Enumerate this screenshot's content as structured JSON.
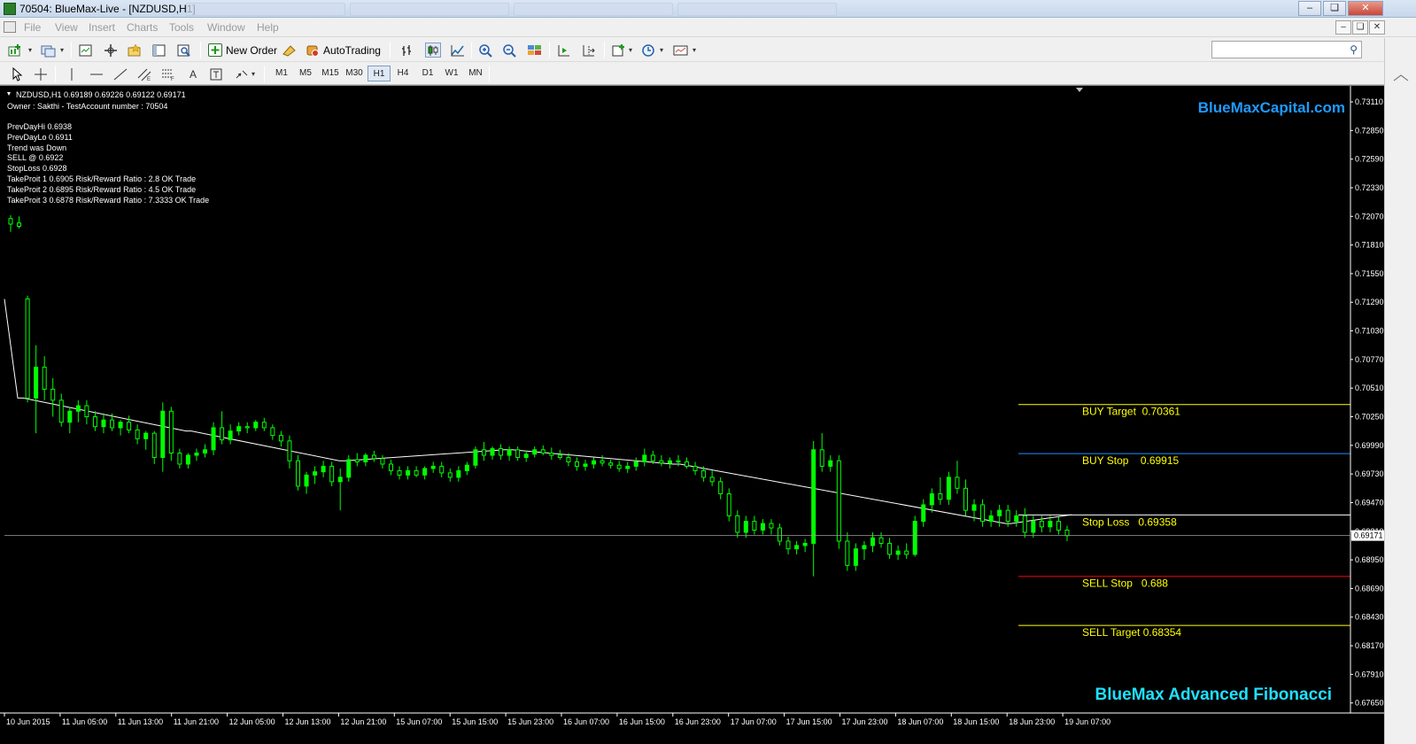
{
  "window": {
    "title": "70504: BlueMax-Live - [NZDUSD,H1]",
    "controls": [
      "minimize",
      "restore",
      "close"
    ]
  },
  "menubar": {
    "items": [
      "File",
      "View",
      "Insert",
      "Charts",
      "Tools",
      "Window",
      "Help"
    ]
  },
  "toolbar": {
    "new_order_label": "New Order",
    "autotrading_label": "AutoTrading",
    "search_placeholder": "",
    "timeframes": [
      "M1",
      "M5",
      "M15",
      "M30",
      "H1",
      "H4",
      "D1",
      "W1",
      "MN"
    ],
    "active_timeframe": "H1"
  },
  "chart_info": {
    "symbol_line": "NZDUSD,H1  0.69189 0.69226 0.69122 0.69171",
    "owner_line": "Owner : Sakthi - TestAccount number : 70504",
    "lines": [
      "PrevDayHi 0.6938",
      "PrevDayLo 0.6911",
      "Trend was Down",
      "SELL @ 0.6922",
      "StopLoss 0.6928",
      "TakeProit 1 0.6905 Risk/Reward Ratio : 2.8 OK Trade",
      "TakeProit 2 0.6895 Risk/Reward Ratio : 4.5 OK Trade",
      "TakeProit 3 0.6878 Risk/Reward Ratio : 7.3333 OK Trade"
    ]
  },
  "branding": {
    "site": "BlueMaxCapital.com",
    "product": "BlueMax Advanced Fibonacci"
  },
  "colors": {
    "background": "#000000",
    "bull_candle": "#00ff00",
    "bear_candle": "#ffffff",
    "grid_text": "#ffffff",
    "level_yellow": "#ffff00",
    "level_blue": "#1e90ff",
    "level_red": "#ff0000",
    "level_white": "#ffffff",
    "brand": "#1e9bff"
  },
  "chart_data": {
    "type": "candlestick",
    "symbol": "NZDUSD",
    "timeframe": "H1",
    "price_axis_ticks": [
      "0.73110",
      "0.72850",
      "0.72590",
      "0.72330",
      "0.72070",
      "0.71810",
      "0.71550",
      "0.71290",
      "0.71030",
      "0.70770",
      "0.70510",
      "0.70250",
      "0.69990",
      "0.69730",
      "0.69470",
      "0.69210",
      "0.68950",
      "0.68690",
      "0.68430",
      "0.68170",
      "0.67910",
      "0.67650"
    ],
    "time_axis_ticks": [
      "10 Jun 2015",
      "11 Jun 05:00",
      "11 Jun 13:00",
      "11 Jun 21:00",
      "12 Jun 05:00",
      "12 Jun 13:00",
      "12 Jun 21:00",
      "15 Jun 07:00",
      "15 Jun 15:00",
      "15 Jun 23:00",
      "16 Jun 07:00",
      "16 Jun 15:00",
      "16 Jun 23:00",
      "17 Jun 07:00",
      "17 Jun 15:00",
      "17 Jun 23:00",
      "18 Jun 07:00",
      "18 Jun 15:00",
      "18 Jun 23:00",
      "19 Jun 07:00"
    ],
    "ylim": [
      0.67575,
      0.73255
    ],
    "current_price": 0.69171,
    "current_price_label": "0.69171",
    "levels": [
      {
        "label": "BUY Target  0.70361",
        "price": 0.70361,
        "color": "#ffff00"
      },
      {
        "label": "BUY Stop    0.69915",
        "price": 0.69915,
        "color": "#1e90ff"
      },
      {
        "label": "Stop Loss   0.69358",
        "price": 0.69358,
        "color": "#ffffff"
      },
      {
        "label": "SELL Stop   0.688",
        "price": 0.688,
        "color": "#ff0000"
      },
      {
        "label": "SELL Target 0.68354",
        "price": 0.68354,
        "color": "#ffff00"
      }
    ],
    "candles_ohlc": [
      [
        0.7205,
        0.7208,
        0.7193,
        0.72
      ],
      [
        0.7201,
        0.7207,
        0.7196,
        0.7198
      ],
      [
        0.7132,
        0.7135,
        0.7038,
        0.7042
      ],
      [
        0.7042,
        0.709,
        0.701,
        0.707
      ],
      [
        0.707,
        0.708,
        0.704,
        0.705
      ],
      [
        0.705,
        0.706,
        0.7025,
        0.704
      ],
      [
        0.704,
        0.7046,
        0.7016,
        0.702
      ],
      [
        0.702,
        0.7034,
        0.701,
        0.703
      ],
      [
        0.703,
        0.704,
        0.702,
        0.7035
      ],
      [
        0.7035,
        0.704,
        0.7018,
        0.7025
      ],
      [
        0.7025,
        0.703,
        0.7012,
        0.7016
      ],
      [
        0.7016,
        0.7028,
        0.701,
        0.7022
      ],
      [
        0.7022,
        0.7028,
        0.7012,
        0.7015
      ],
      [
        0.7015,
        0.7022,
        0.7008,
        0.702
      ],
      [
        0.702,
        0.7026,
        0.701,
        0.7013
      ],
      [
        0.7013,
        0.7018,
        0.7,
        0.7005
      ],
      [
        0.7005,
        0.7012,
        0.6995,
        0.701
      ],
      [
        0.701,
        0.7012,
        0.6982,
        0.6988
      ],
      [
        0.6988,
        0.7038,
        0.6975,
        0.703
      ],
      [
        0.703,
        0.7034,
        0.6985,
        0.6992
      ],
      [
        0.6992,
        0.6996,
        0.6978,
        0.6982
      ],
      [
        0.6982,
        0.6992,
        0.6978,
        0.699
      ],
      [
        0.699,
        0.6996,
        0.6985,
        0.6992
      ],
      [
        0.6992,
        0.7,
        0.6988,
        0.6995
      ],
      [
        0.6995,
        0.702,
        0.699,
        0.7015
      ],
      [
        0.7015,
        0.703,
        0.7,
        0.7004
      ],
      [
        0.7004,
        0.7018,
        0.7,
        0.7012
      ],
      [
        0.7012,
        0.702,
        0.7008,
        0.7016
      ],
      [
        0.7016,
        0.702,
        0.701,
        0.7015
      ],
      [
        0.7015,
        0.7022,
        0.7012,
        0.702
      ],
      [
        0.702,
        0.7024,
        0.7012,
        0.7015
      ],
      [
        0.7015,
        0.7018,
        0.7004,
        0.7008
      ],
      [
        0.7008,
        0.7012,
        0.6998,
        0.7003
      ],
      [
        0.7003,
        0.7008,
        0.6978,
        0.6985
      ],
      [
        0.6985,
        0.699,
        0.6958,
        0.6962
      ],
      [
        0.6962,
        0.6975,
        0.6955,
        0.6972
      ],
      [
        0.6972,
        0.698,
        0.6964,
        0.6975
      ],
      [
        0.6975,
        0.6985,
        0.697,
        0.698
      ],
      [
        0.698,
        0.6984,
        0.6962,
        0.6966
      ],
      [
        0.6966,
        0.6978,
        0.694,
        0.697
      ],
      [
        0.697,
        0.699,
        0.6966,
        0.6986
      ],
      [
        0.6986,
        0.6992,
        0.698,
        0.6984
      ],
      [
        0.6984,
        0.6992,
        0.698,
        0.699
      ],
      [
        0.699,
        0.6994,
        0.6984,
        0.6987
      ],
      [
        0.6987,
        0.699,
        0.6978,
        0.6982
      ],
      [
        0.6982,
        0.6986,
        0.6972,
        0.6976
      ],
      [
        0.6976,
        0.698,
        0.6968,
        0.6972
      ],
      [
        0.6972,
        0.698,
        0.6968,
        0.6976
      ],
      [
        0.6976,
        0.698,
        0.697,
        0.6972
      ],
      [
        0.6972,
        0.698,
        0.6968,
        0.6978
      ],
      [
        0.6978,
        0.6984,
        0.6974,
        0.698
      ],
      [
        0.698,
        0.6984,
        0.697,
        0.6974
      ],
      [
        0.6974,
        0.6978,
        0.6966,
        0.697
      ],
      [
        0.697,
        0.698,
        0.6966,
        0.6976
      ],
      [
        0.6976,
        0.6984,
        0.6972,
        0.6981
      ],
      [
        0.6981,
        0.6998,
        0.6978,
        0.6995
      ],
      [
        0.6995,
        0.7002,
        0.6985,
        0.699
      ],
      [
        0.699,
        0.6998,
        0.6986,
        0.6996
      ],
      [
        0.6996,
        0.7,
        0.6986,
        0.699
      ],
      [
        0.699,
        0.6998,
        0.6985,
        0.6995
      ],
      [
        0.6995,
        0.6998,
        0.6985,
        0.6988
      ],
      [
        0.6988,
        0.6994,
        0.6984,
        0.6991
      ],
      [
        0.6991,
        0.6998,
        0.6988,
        0.6995
      ],
      [
        0.6995,
        0.6999,
        0.699,
        0.6992
      ],
      [
        0.6992,
        0.6997,
        0.6986,
        0.699
      ],
      [
        0.699,
        0.6995,
        0.6986,
        0.6988
      ],
      [
        0.6988,
        0.6992,
        0.698,
        0.6984
      ],
      [
        0.6984,
        0.6988,
        0.6976,
        0.698
      ],
      [
        0.698,
        0.6986,
        0.6976,
        0.6982
      ],
      [
        0.6982,
        0.6988,
        0.6978,
        0.6985
      ],
      [
        0.6985,
        0.699,
        0.698,
        0.6983
      ],
      [
        0.6983,
        0.6986,
        0.6978,
        0.6981
      ],
      [
        0.6981,
        0.6985,
        0.6975,
        0.6978
      ],
      [
        0.6978,
        0.6984,
        0.6974,
        0.698
      ],
      [
        0.698,
        0.6988,
        0.6976,
        0.6984
      ],
      [
        0.6984,
        0.6996,
        0.698,
        0.699
      ],
      [
        0.699,
        0.6994,
        0.6982,
        0.6985
      ],
      [
        0.6985,
        0.699,
        0.698,
        0.6983
      ],
      [
        0.6983,
        0.6988,
        0.6978,
        0.6985
      ],
      [
        0.6985,
        0.699,
        0.698,
        0.6984
      ],
      [
        0.6984,
        0.6988,
        0.6978,
        0.698
      ],
      [
        0.698,
        0.6984,
        0.6972,
        0.6976
      ],
      [
        0.6976,
        0.698,
        0.6966,
        0.697
      ],
      [
        0.697,
        0.6976,
        0.6962,
        0.6966
      ],
      [
        0.6966,
        0.697,
        0.695,
        0.6955
      ],
      [
        0.6955,
        0.696,
        0.693,
        0.6935
      ],
      [
        0.6935,
        0.694,
        0.6915,
        0.692
      ],
      [
        0.692,
        0.6935,
        0.6915,
        0.693
      ],
      [
        0.693,
        0.6935,
        0.6918,
        0.6922
      ],
      [
        0.6922,
        0.6932,
        0.6918,
        0.6928
      ],
      [
        0.6928,
        0.6932,
        0.6918,
        0.6924
      ],
      [
        0.6924,
        0.6928,
        0.6908,
        0.6912
      ],
      [
        0.6912,
        0.6916,
        0.69,
        0.6905
      ],
      [
        0.6905,
        0.6912,
        0.69,
        0.6908
      ],
      [
        0.6908,
        0.6914,
        0.6902,
        0.691
      ],
      [
        0.691,
        0.7003,
        0.688,
        0.6995
      ],
      [
        0.6995,
        0.701,
        0.6975,
        0.698
      ],
      [
        0.698,
        0.699,
        0.6975,
        0.6985
      ],
      [
        0.6985,
        0.699,
        0.6905,
        0.6912
      ],
      [
        0.6912,
        0.692,
        0.6885,
        0.689
      ],
      [
        0.689,
        0.691,
        0.6885,
        0.6905
      ],
      [
        0.6905,
        0.6912,
        0.6895,
        0.6908
      ],
      [
        0.6908,
        0.692,
        0.6902,
        0.6915
      ],
      [
        0.6915,
        0.692,
        0.6906,
        0.691
      ],
      [
        0.691,
        0.6915,
        0.6896,
        0.69
      ],
      [
        0.69,
        0.6908,
        0.6895,
        0.6903
      ],
      [
        0.6903,
        0.691,
        0.6896,
        0.69
      ],
      [
        0.69,
        0.6935,
        0.6898,
        0.693
      ],
      [
        0.693,
        0.695,
        0.6925,
        0.6945
      ],
      [
        0.6945,
        0.696,
        0.6938,
        0.6955
      ],
      [
        0.6955,
        0.697,
        0.6945,
        0.695
      ],
      [
        0.695,
        0.6975,
        0.6945,
        0.697
      ],
      [
        0.697,
        0.6985,
        0.6955,
        0.696
      ],
      [
        0.696,
        0.6968,
        0.6935,
        0.694
      ],
      [
        0.694,
        0.695,
        0.693,
        0.6945
      ],
      [
        0.6945,
        0.695,
        0.6925,
        0.693
      ],
      [
        0.693,
        0.694,
        0.6925,
        0.6935
      ],
      [
        0.6935,
        0.6945,
        0.6925,
        0.694
      ],
      [
        0.694,
        0.6945,
        0.6925,
        0.693
      ],
      [
        0.693,
        0.694,
        0.6925,
        0.6935
      ],
      [
        0.6935,
        0.6942,
        0.6915,
        0.692
      ],
      [
        0.692,
        0.6935,
        0.6915,
        0.693
      ],
      [
        0.693,
        0.6935,
        0.692,
        0.6925
      ],
      [
        0.6925,
        0.6935,
        0.692,
        0.693
      ],
      [
        0.693,
        0.6934,
        0.6918,
        0.6922
      ],
      [
        0.6922,
        0.6926,
        0.6912,
        0.6917
      ]
    ],
    "fib_line_prices": [
      [
        0.7132,
        0.7132
      ],
      [
        0.7042,
        0.7042
      ],
      [
        0.7042,
        0.7042
      ],
      [
        0.7012,
        0.7012
      ],
      [
        0.7012,
        0.7012
      ],
      [
        0.6985,
        0.6985
      ],
      [
        0.6985,
        0.6985
      ],
      [
        0.6995,
        0.6995
      ],
      [
        0.6995,
        0.6995
      ],
      [
        0.6982,
        0.6982
      ],
      [
        0.6982,
        0.6982
      ],
      [
        0.6928,
        0.6928
      ],
      [
        0.6928,
        0.6928
      ],
      [
        0.6936,
        0.6936
      ]
    ]
  }
}
